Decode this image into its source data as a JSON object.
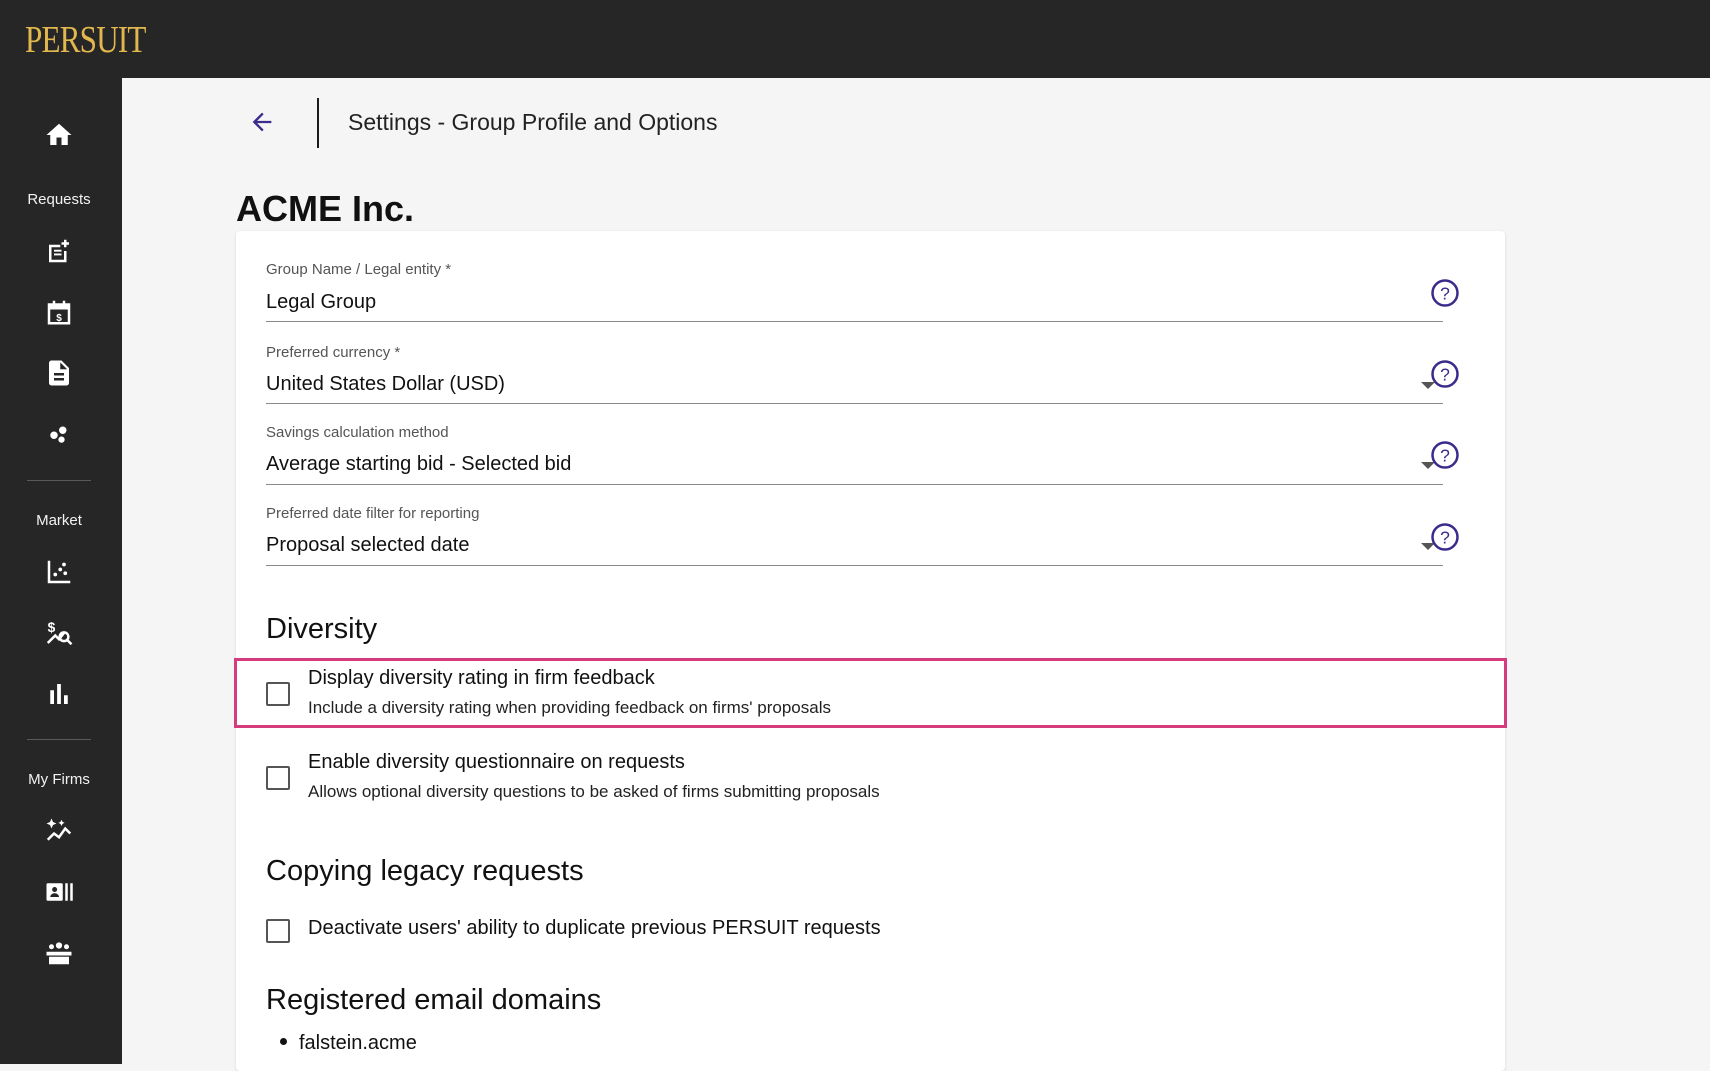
{
  "app": {
    "logo_text": "PERSUIT",
    "brand_color": "#e2b74e",
    "highlight_color": "#d63b7e",
    "accent_color": "#3c2a8c"
  },
  "sidebar": {
    "home_icon": "home-icon",
    "sections": [
      {
        "label": "Requests",
        "icons": [
          "new-request-icon",
          "calendar-dollar-icon",
          "document-icon",
          "bubbles-icon"
        ]
      },
      {
        "label": "Market",
        "icons": [
          "scatter-chart-icon",
          "price-search-icon",
          "bar-chart-icon"
        ]
      },
      {
        "label": "My Firms",
        "icons": [
          "sparkle-trend-icon",
          "contact-card-icon",
          "team-icon"
        ]
      }
    ]
  },
  "header": {
    "back_icon": "arrow-left-icon",
    "subtitle": "Settings - Group Profile and Options"
  },
  "page": {
    "title": "ACME Inc."
  },
  "form": {
    "group_name": {
      "label": "Group Name / Legal entity *",
      "value": "Legal Group"
    },
    "currency": {
      "label": "Preferred currency *",
      "value": "United States Dollar (USD)"
    },
    "savings": {
      "label": "Savings calculation method",
      "value": "Average starting bid - Selected bid"
    },
    "date_filter": {
      "label": "Preferred date filter for reporting",
      "value": "Proposal selected date"
    }
  },
  "diversity": {
    "title": "Diversity",
    "rating": {
      "label": "Display diversity rating in firm feedback",
      "description": "Include a diversity rating when providing feedback on firms' proposals",
      "checked": false
    },
    "questionnaire": {
      "label": "Enable diversity questionnaire on requests",
      "description": "Allows optional diversity questions to be asked of firms submitting proposals",
      "checked": false
    }
  },
  "legacy": {
    "title": "Copying legacy requests",
    "deactivate": {
      "label": "Deactivate users' ability to duplicate previous PERSUIT requests",
      "checked": false
    }
  },
  "domains": {
    "title": "Registered email domains",
    "items": [
      "falstein.acme"
    ]
  }
}
